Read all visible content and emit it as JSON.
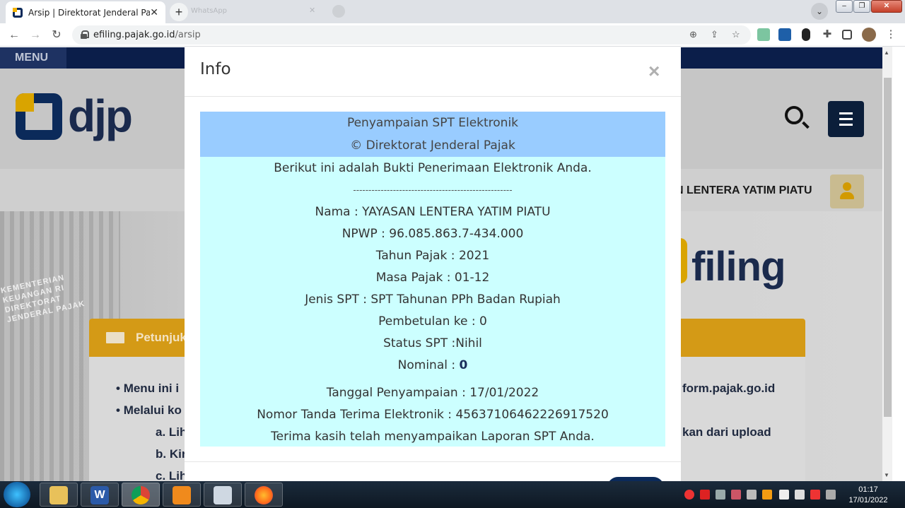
{
  "browser": {
    "tab_title": "Arsip | Direktorat Jenderal Pajak",
    "tab_close": "✕",
    "new_tab": "+",
    "ghost_tab_title": "WhatsApp",
    "url_host": "efiling.pajak.go.id",
    "url_path": "/arsip"
  },
  "page": {
    "menu_label": "MENU",
    "logo_text": "djp",
    "user_name": "N LENTERA YATIM PIATU",
    "building_text": "KEMENTERIAN KEUANGAN RI DIREKTORAT JENDERAL PAJAK",
    "efiling_text": "filing",
    "card_title": "Petunjuk",
    "card_lines": [
      "Menu ini i",
      "Melalui ko",
      "a. Lih",
      "b. Kir",
      "c. Lih"
    ],
    "card_right_lines": [
      "form.pajak.go.id",
      "kan dari upload"
    ]
  },
  "modal": {
    "title": "Info",
    "close": "×",
    "header_lines": [
      "Penyampaian SPT Elektronik",
      "© Direktorat Jenderal Pajak"
    ],
    "intro": "Berikut ini adalah Bukti Penerimaan Elektronik Anda.",
    "separator": "----------------------------------------------------",
    "nama": "Nama : YAYASAN LENTERA YATIM PIATU",
    "npwp": "NPWP : 96.085.863.7-434.000",
    "tahun_pajak": "Tahun Pajak : 2021",
    "masa_pajak": "Masa Pajak : 01-12",
    "jenis_spt": "Jenis SPT : SPT Tahunan PPh Badan Rupiah",
    "pembetulan": "Pembetulan ke : 0",
    "status_spt": "Status SPT :Nihil",
    "nominal_label": "Nominal : ",
    "nominal_value": "0",
    "tanggal": "Tanggal Penyampaian : 17/01/2022",
    "nomor": "Nomor Tanda Terima Elektronik : 456371064622269175​20",
    "terima_kasih": "Terima kasih telah menyampaikan Laporan SPT Anda."
  },
  "taskbar": {
    "time": "01:17",
    "date": "17/01/2022"
  },
  "colors": {
    "receipt_header": "#99ccff",
    "receipt_body": "#ccffff",
    "navy": "#0b1e4a",
    "accent_gold": "#d49a16"
  }
}
